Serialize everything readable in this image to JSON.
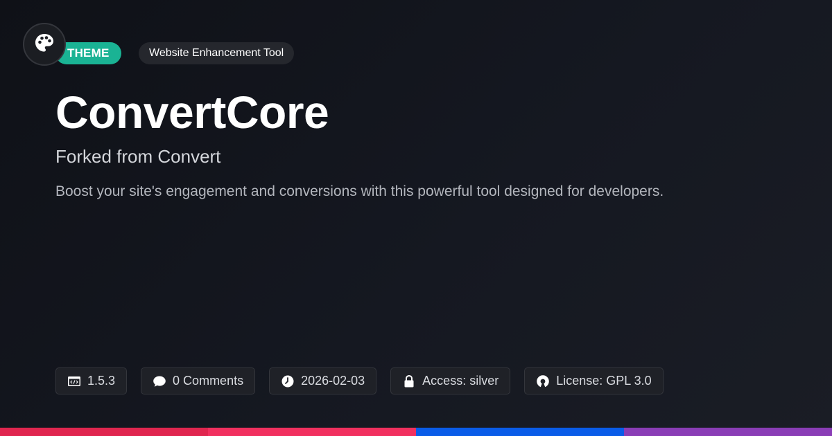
{
  "header": {
    "logo_icon": "palette-icon",
    "type_label": "THEME",
    "category_label": "Website Enhancement Tool"
  },
  "main": {
    "title": "ConvertCore",
    "subtitle": "Forked from Convert",
    "description": "Boost your site's engagement and conversions with this powerful tool designed for developers."
  },
  "meta": {
    "version": "1.5.3",
    "comments": "0 Comments",
    "date": "2026-02-03",
    "access": "Access: silver",
    "license": "License: GPL 3.0"
  },
  "colors": {
    "accent": "#1ab394",
    "bar": [
      "#e0264f",
      "#f1305f",
      "#0a5ce8",
      "#8a3db6"
    ]
  }
}
